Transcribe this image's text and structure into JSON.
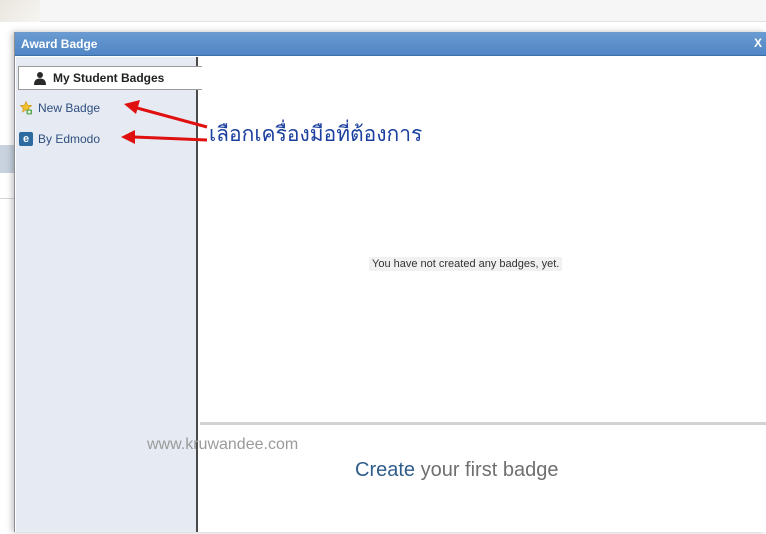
{
  "modal": {
    "title": "Award Badge",
    "close_label": "X"
  },
  "sidebar": {
    "tab_label": "My Student Badges",
    "items": [
      {
        "label": "New Badge",
        "icon": "badge-icon"
      },
      {
        "label": "By Edmodo",
        "icon": "edmodo-logo-icon",
        "icon_glyph": "e"
      }
    ]
  },
  "main": {
    "empty_message": "You have not created any badges, yet.",
    "create_accent": "Create",
    "create_rest": " your first badge"
  },
  "watermark": "www.kruwandee.com",
  "annotation": {
    "text": "เลือกเครื่องมือที่ต้องการ",
    "color": "#1a3f9e",
    "arrow_color": "#e01010"
  },
  "colors": {
    "header_blue": "#4f86c6",
    "sidebar_bg": "#e6ebf3",
    "link_blue": "#2f4f7f"
  }
}
